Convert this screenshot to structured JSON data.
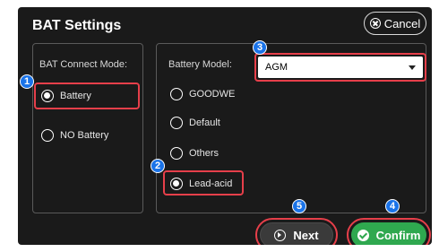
{
  "header": {
    "title": "BAT Settings",
    "cancel_label": "Cancel"
  },
  "connect_mode": {
    "label": "BAT Connect Mode:",
    "options": [
      {
        "label": "Battery",
        "checked": true
      },
      {
        "label": "NO Battery",
        "checked": false
      }
    ]
  },
  "battery_model": {
    "label": "Battery Model:",
    "selected": "AGM",
    "options": [
      {
        "label": "GOODWE",
        "checked": false
      },
      {
        "label": "Default",
        "checked": false
      },
      {
        "label": "Others",
        "checked": false
      },
      {
        "label": "Lead-acid",
        "checked": true
      }
    ]
  },
  "footer": {
    "next_label": "Next",
    "confirm_label": "Confirm"
  },
  "badges": {
    "b1": "1",
    "b2": "2",
    "b3": "3",
    "b4": "4",
    "b5": "5"
  },
  "colors": {
    "highlight": "#e63f4a",
    "badge": "#1a73e8",
    "confirm": "#2fa84f",
    "background": "#1a1a1a"
  }
}
